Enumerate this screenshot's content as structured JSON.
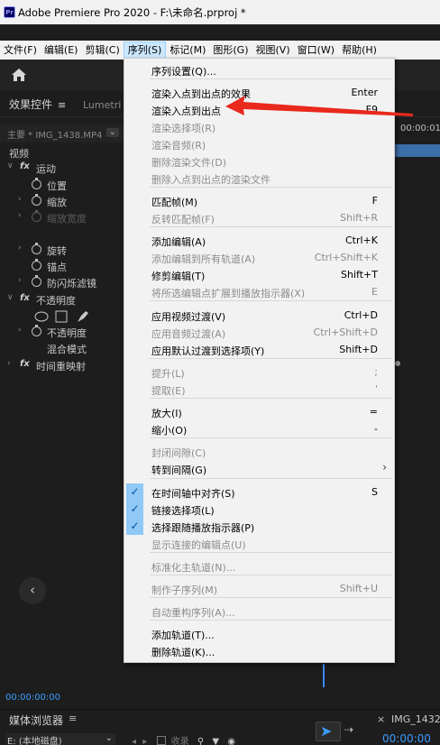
{
  "window": {
    "app_icon": "Pr",
    "title": "Adobe Premiere Pro 2020 - F:\\未命名.prproj *"
  },
  "menubar": {
    "items": [
      "文件(F)",
      "编辑(E)",
      "剪辑(C)",
      "序列(S)",
      "标记(M)",
      "图形(G)",
      "视图(V)",
      "窗口(W)",
      "帮助(H)"
    ]
  },
  "panel": {
    "tab_effects": "效果控件",
    "tab_menu_glyph": "≡",
    "tab_lumetri": "Lumetri 范",
    "source": "主要 * IMG_1438.MP4",
    "video_header": "视频",
    "effects": {
      "motion": "运动",
      "position": "位置",
      "scale": "缩放",
      "scale_width": "缩放宽度",
      "rotation": "旋转",
      "anchor": "锚点",
      "anti_flicker": "防闪烁滤镜",
      "opacity": "不透明度",
      "opacity_value": "不透明度",
      "blend_mode": "混合模式",
      "time_remap": "时间重映射"
    },
    "timeline_time": "00:00:01",
    "timecode": "00:00:00:00"
  },
  "bottom": {
    "media_browser": "媒体浏览器",
    "media_menu": "≡",
    "drive": "E: (本地磁盘)",
    "collect": "收录",
    "img_tab": "IMG_1432",
    "timecode_right": "00:00:00"
  },
  "menu": {
    "items": [
      {
        "label": "序列设置(Q)...",
        "shortcut": "",
        "disabled": false
      },
      {
        "label": "渲染入点到出点的效果",
        "shortcut": "Enter",
        "disabled": false
      },
      {
        "label": "渲染入点到出点",
        "shortcut": "F9",
        "disabled": false
      },
      {
        "label": "渲染选择项(R)",
        "shortcut": "",
        "disabled": true
      },
      {
        "label": "渲染音频(R)",
        "shortcut": "",
        "disabled": true
      },
      {
        "label": "删除渲染文件(D)",
        "shortcut": "",
        "disabled": true
      },
      {
        "label": "删除入点到出点的渲染文件",
        "shortcut": "",
        "disabled": true
      },
      {
        "label": "匹配帧(M)",
        "shortcut": "F",
        "disabled": false
      },
      {
        "label": "反转匹配帧(F)",
        "shortcut": "Shift+R",
        "disabled": true
      },
      {
        "label": "添加编辑(A)",
        "shortcut": "Ctrl+K",
        "disabled": false
      },
      {
        "label": "添加编辑到所有轨道(A)",
        "shortcut": "Ctrl+Shift+K",
        "disabled": true
      },
      {
        "label": "修剪编辑(T)",
        "shortcut": "Shift+T",
        "disabled": false
      },
      {
        "label": "将所选编辑点扩展到播放指示器(X)",
        "shortcut": "E",
        "disabled": true
      },
      {
        "label": "应用视频过渡(V)",
        "shortcut": "Ctrl+D",
        "disabled": false
      },
      {
        "label": "应用音频过渡(A)",
        "shortcut": "Ctrl+Shift+D",
        "disabled": true
      },
      {
        "label": "应用默认过渡到选择项(Y)",
        "shortcut": "Shift+D",
        "disabled": false
      },
      {
        "label": "提升(L)",
        "shortcut": ";",
        "disabled": true
      },
      {
        "label": "提取(E)",
        "shortcut": "'",
        "disabled": true
      },
      {
        "label": "放大(I)",
        "shortcut": "=",
        "disabled": false
      },
      {
        "label": "缩小(O)",
        "shortcut": "-",
        "disabled": false
      },
      {
        "label": "封闭间隙(C)",
        "shortcut": "",
        "disabled": true
      },
      {
        "label": "转到间隔(G)",
        "shortcut": "",
        "disabled": false,
        "submenu": "›"
      },
      {
        "label": "在时间轴中对齐(S)",
        "shortcut": "S",
        "disabled": false,
        "check": "✓"
      },
      {
        "label": "链接选择项(L)",
        "shortcut": "",
        "disabled": false,
        "check": "✓"
      },
      {
        "label": "选择跟随播放指示器(P)",
        "shortcut": "",
        "disabled": false,
        "check": "✓"
      },
      {
        "label": "显示连接的编辑点(U)",
        "shortcut": "",
        "disabled": true
      },
      {
        "label": "标准化主轨道(N)...",
        "shortcut": "",
        "disabled": true
      },
      {
        "label": "制作子序列(M)",
        "shortcut": "Shift+U",
        "disabled": true
      },
      {
        "label": "自动重构序列(A)...",
        "shortcut": "",
        "disabled": true
      },
      {
        "label": "添加轨道(T)...",
        "shortcut": "",
        "disabled": false
      },
      {
        "label": "删除轨道(K)...",
        "shortcut": "",
        "disabled": false
      }
    ]
  },
  "colors": {
    "accent_blue": "#3b9cff",
    "annotation_red": "#e8291c"
  }
}
